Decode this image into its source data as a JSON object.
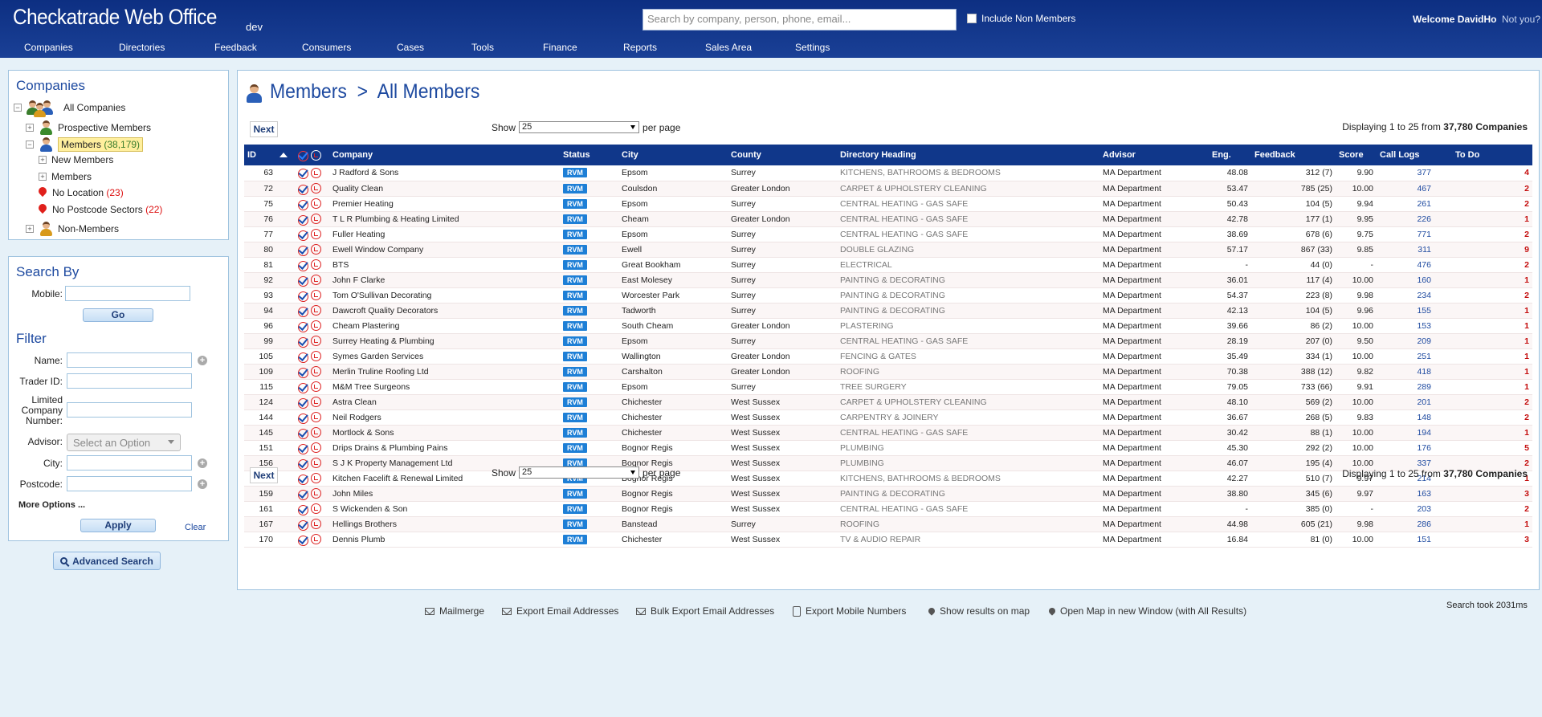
{
  "header": {
    "brand": "Checkatrade Web Office",
    "env": "dev",
    "search_placeholder": "Search by company, person, phone, email...",
    "include_non_members": "Include Non Members",
    "welcome": "Welcome DavidHo",
    "not_you": "Not you?",
    "nav": [
      "Companies",
      "Directories",
      "Feedback",
      "Consumers",
      "Cases",
      "Tools",
      "Finance",
      "Reports",
      "Sales Area",
      "Settings"
    ]
  },
  "companies_panel": {
    "title": "Companies",
    "all": "All Companies",
    "prospective": "Prospective Members",
    "members": "Members",
    "members_count": "(38,179)",
    "new_members": "New Members",
    "members_sub": "Members",
    "no_location": "No Location",
    "no_location_count": "(23)",
    "no_postcode": "No Postcode Sectors",
    "no_postcode_count": "(22)",
    "non_members": "Non-Members"
  },
  "search_panel": {
    "title": "Search By",
    "mobile_label": "Mobile:",
    "go": "Go",
    "filter_title": "Filter",
    "name_label": "Name:",
    "trader_label": "Trader ID:",
    "limited_label_1": "Limited",
    "limited_label_2": "Company",
    "limited_label_3": "Number:",
    "advisor_label": "Advisor:",
    "advisor_placeholder": "Select an Option",
    "city_label": "City:",
    "postcode_label": "Postcode:",
    "more_options": "More Options ...",
    "apply": "Apply",
    "clear": "Clear",
    "advanced": "Advanced Search"
  },
  "main": {
    "title_part1": "Members",
    "title_sep": ">",
    "title_part2": "All Members",
    "next": "Next",
    "show": "Show",
    "per_page_value": "25",
    "per_page": "per page",
    "displaying": "Displaying 1 to 25 from",
    "total": "37,780 Companies",
    "columns": [
      "ID",
      "",
      "",
      "Company",
      "Status",
      "City",
      "County",
      "Directory Heading",
      "Advisor",
      "Eng.",
      "Feedback",
      "Score",
      "Call Logs",
      "To Do"
    ],
    "rows": [
      [
        "63",
        "J Radford & Sons",
        "RVM",
        "Epsom",
        "Surrey",
        "KITCHENS, BATHROOMS & BEDROOMS",
        "MA Department",
        "48.08",
        "312 (7)",
        "9.90",
        "377",
        "4"
      ],
      [
        "72",
        "Quality Clean",
        "RVM",
        "Coulsdon",
        "Greater London",
        "CARPET & UPHOLSTERY CLEANING",
        "MA Department",
        "53.47",
        "785 (25)",
        "10.00",
        "467",
        "2"
      ],
      [
        "75",
        "Premier Heating",
        "RVM",
        "Epsom",
        "Surrey",
        "CENTRAL HEATING - GAS SAFE",
        "MA Department",
        "50.43",
        "104 (5)",
        "9.94",
        "261",
        "2"
      ],
      [
        "76",
        "T L R Plumbing & Heating Limited",
        "RVM",
        "Cheam",
        "Greater London",
        "CENTRAL HEATING - GAS SAFE",
        "MA Department",
        "42.78",
        "177 (1)",
        "9.95",
        "226",
        "1"
      ],
      [
        "77",
        "Fuller Heating",
        "RVM",
        "Epsom",
        "Surrey",
        "CENTRAL HEATING - GAS SAFE",
        "MA Department",
        "38.69",
        "678 (6)",
        "9.75",
        "771",
        "2"
      ],
      [
        "80",
        "Ewell Window Company",
        "RVM",
        "Ewell",
        "Surrey",
        "DOUBLE GLAZING",
        "MA Department",
        "57.17",
        "867 (33)",
        "9.85",
        "311",
        "9"
      ],
      [
        "81",
        "BTS",
        "RVM",
        "Great Bookham",
        "Surrey",
        "ELECTRICAL",
        "MA Department",
        "-",
        "44 (0)",
        "-",
        "476",
        "2"
      ],
      [
        "92",
        "John F Clarke",
        "RVM",
        "East Molesey",
        "Surrey",
        "PAINTING & DECORATING",
        "MA Department",
        "36.01",
        "117 (4)",
        "10.00",
        "160",
        "1"
      ],
      [
        "93",
        "Tom O'Sullivan Decorating",
        "RVM",
        "Worcester Park",
        "Surrey",
        "PAINTING & DECORATING",
        "MA Department",
        "54.37",
        "223 (8)",
        "9.98",
        "234",
        "2"
      ],
      [
        "94",
        "Dawcroft Quality Decorators",
        "RVM",
        "Tadworth",
        "Surrey",
        "PAINTING & DECORATING",
        "MA Department",
        "42.13",
        "104 (5)",
        "9.96",
        "155",
        "1"
      ],
      [
        "96",
        "Cheam Plastering",
        "RVM",
        "South Cheam",
        "Greater London",
        "PLASTERING",
        "MA Department",
        "39.66",
        "86 (2)",
        "10.00",
        "153",
        "1"
      ],
      [
        "99",
        "Surrey Heating & Plumbing",
        "RVM",
        "Epsom",
        "Surrey",
        "CENTRAL HEATING - GAS SAFE",
        "MA Department",
        "28.19",
        "207 (0)",
        "9.50",
        "209",
        "1"
      ],
      [
        "105",
        "Symes Garden Services",
        "RVM",
        "Wallington",
        "Greater London",
        "FENCING & GATES",
        "MA Department",
        "35.49",
        "334 (1)",
        "10.00",
        "251",
        "1"
      ],
      [
        "109",
        "Merlin Truline Roofing Ltd",
        "RVM",
        "Carshalton",
        "Greater London",
        "ROOFING",
        "MA Department",
        "70.38",
        "388 (12)",
        "9.82",
        "418",
        "1"
      ],
      [
        "115",
        "M&M Tree Surgeons",
        "RVM",
        "Epsom",
        "Surrey",
        "TREE SURGERY",
        "MA Department",
        "79.05",
        "733 (66)",
        "9.91",
        "289",
        "1"
      ],
      [
        "124",
        "Astra Clean",
        "RVM",
        "Chichester",
        "West Sussex",
        "CARPET & UPHOLSTERY CLEANING",
        "MA Department",
        "48.10",
        "569 (2)",
        "10.00",
        "201",
        "2"
      ],
      [
        "144",
        "Neil Rodgers",
        "RVM",
        "Chichester",
        "West Sussex",
        "CARPENTRY & JOINERY",
        "MA Department",
        "36.67",
        "268 (5)",
        "9.83",
        "148",
        "2"
      ],
      [
        "145",
        "Mortlock & Sons",
        "RVM",
        "Chichester",
        "West Sussex",
        "CENTRAL HEATING - GAS SAFE",
        "MA Department",
        "30.42",
        "88 (1)",
        "10.00",
        "194",
        "1"
      ],
      [
        "151",
        "Drips Drains & Plumbing Pains",
        "RVM",
        "Bognor Regis",
        "West Sussex",
        "PLUMBING",
        "MA Department",
        "45.30",
        "292 (2)",
        "10.00",
        "176",
        "5"
      ],
      [
        "156",
        "S J K Property Management Ltd",
        "RVM",
        "Bognor Regis",
        "West Sussex",
        "PLUMBING",
        "MA Department",
        "46.07",
        "195 (4)",
        "10.00",
        "337",
        "2"
      ],
      [
        "157",
        "Kitchen Facelift & Renewal Limited",
        "RVM",
        "Bognor Regis",
        "West Sussex",
        "KITCHENS, BATHROOMS & BEDROOMS",
        "MA Department",
        "42.27",
        "510 (7)",
        "9.97",
        "214",
        "1"
      ],
      [
        "159",
        "John Miles",
        "RVM",
        "Bognor Regis",
        "West Sussex",
        "PAINTING & DECORATING",
        "MA Department",
        "38.80",
        "345 (6)",
        "9.97",
        "163",
        "3"
      ],
      [
        "161",
        "S Wickenden & Son",
        "RVM",
        "Bognor Regis",
        "West Sussex",
        "CENTRAL HEATING - GAS SAFE",
        "MA Department",
        "-",
        "385 (0)",
        "-",
        "203",
        "2"
      ],
      [
        "167",
        "Hellings Brothers",
        "RVM",
        "Banstead",
        "Surrey",
        "ROOFING",
        "MA Department",
        "44.98",
        "605 (21)",
        "9.98",
        "286",
        "1"
      ],
      [
        "170",
        "Dennis Plumb",
        "RVM",
        "Chichester",
        "West Sussex",
        "TV & AUDIO REPAIR",
        "MA Department",
        "16.84",
        "81 (0)",
        "10.00",
        "151",
        "3"
      ]
    ]
  },
  "footer": {
    "mailmerge": "Mailmerge",
    "export_email": "Export Email Addresses",
    "bulk_export": "Bulk Export Email Addresses",
    "export_mobile": "Export Mobile Numbers",
    "show_map": "Show results on map",
    "open_map": "Open Map in new Window (with All Results)",
    "search_took": "Search took 2031ms"
  },
  "colors": {
    "header": "#10378a",
    "accent": "#1e4aa0",
    "todo": "#c40c0c",
    "status_badge": "#1e7fd6"
  }
}
